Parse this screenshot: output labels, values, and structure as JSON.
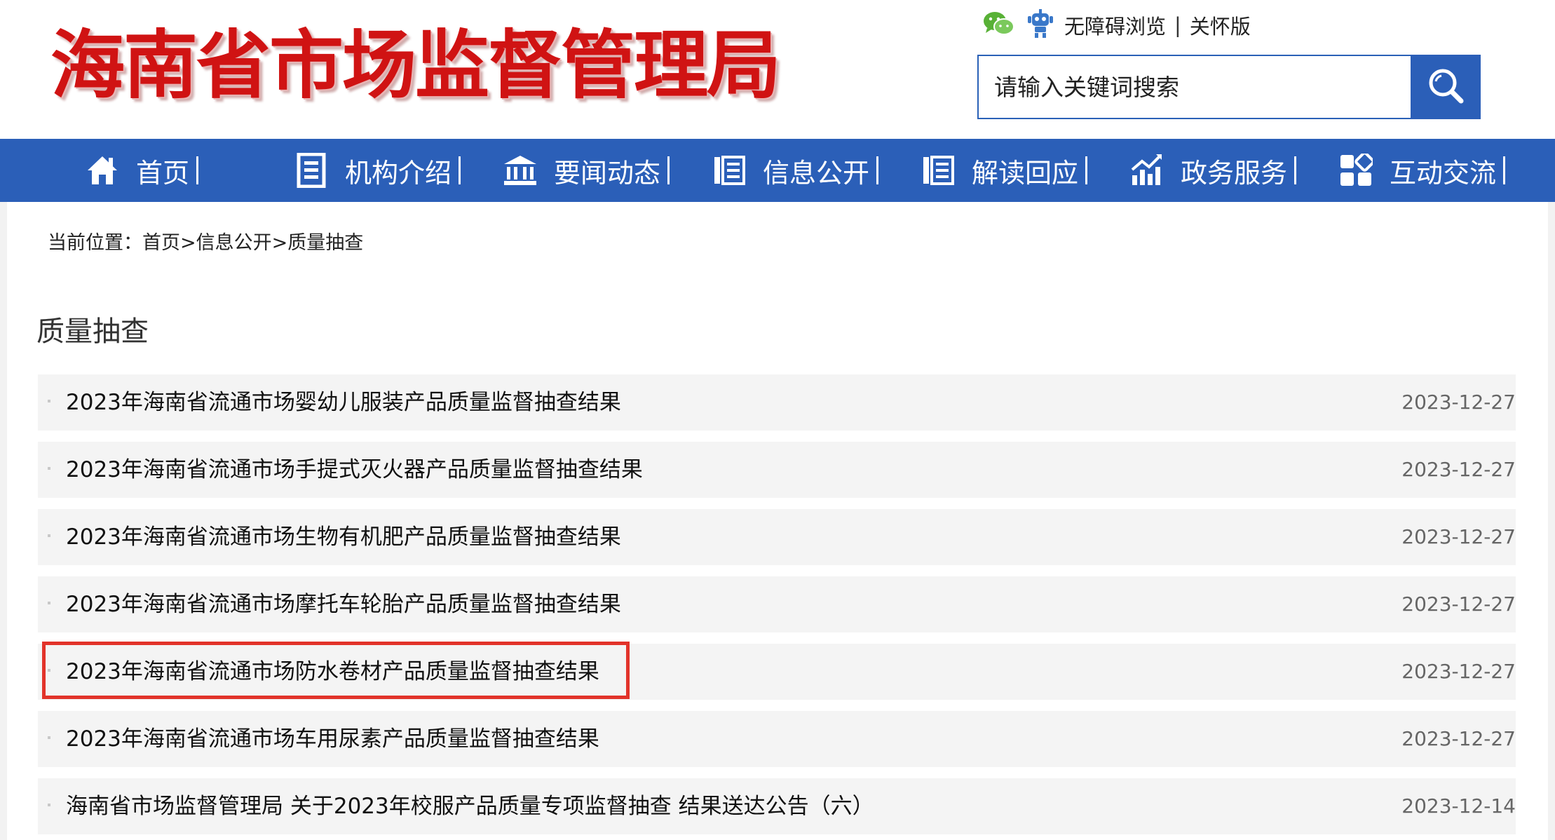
{
  "header": {
    "logo_text": "海南省市场监督管理局",
    "top_links": {
      "wechat_icon": "wechat-icon",
      "accessibility_icon": "robot-icon",
      "accessible_browse": "无障碍浏览",
      "separator": "|",
      "care_version": "关怀版"
    },
    "search": {
      "placeholder": "请输入关键词搜索",
      "button_icon": "search-icon"
    }
  },
  "nav": {
    "items": [
      {
        "label": "首页",
        "icon": "home-icon"
      },
      {
        "label": "机构介绍",
        "icon": "document-icon"
      },
      {
        "label": "要闻动态",
        "icon": "building-icon"
      },
      {
        "label": "信息公开",
        "icon": "list-icon"
      },
      {
        "label": "解读回应",
        "icon": "list-icon"
      },
      {
        "label": "政务服务",
        "icon": "chart-icon"
      },
      {
        "label": "互动交流",
        "icon": "grid-icon"
      }
    ]
  },
  "breadcrumb": {
    "prefix": "当前位置：",
    "items": [
      "首页",
      "信息公开",
      "质量抽查"
    ],
    "separator": ">"
  },
  "section": {
    "title": "质量抽查"
  },
  "articles": [
    {
      "title": "2023年海南省流通市场婴幼儿服装产品质量监督抽查结果",
      "date": "2023-12-27",
      "highlighted": false
    },
    {
      "title": "2023年海南省流通市场手提式灭火器产品质量监督抽查结果",
      "date": "2023-12-27",
      "highlighted": false
    },
    {
      "title": "2023年海南省流通市场生物有机肥产品质量监督抽查结果",
      "date": "2023-12-27",
      "highlighted": false
    },
    {
      "title": "2023年海南省流通市场摩托车轮胎产品质量监督抽查结果",
      "date": "2023-12-27",
      "highlighted": false
    },
    {
      "title": "2023年海南省流通市场防水卷材产品质量监督抽查结果",
      "date": "2023-12-27",
      "highlighted": true
    },
    {
      "title": "2023年海南省流通市场车用尿素产品质量监督抽查结果",
      "date": "2023-12-27",
      "highlighted": false
    },
    {
      "title": "海南省市场监督管理局 关于2023年校服产品质量专项监督抽查 结果送达公告（六）",
      "date": "2023-12-14",
      "highlighted": false
    }
  ],
  "colors": {
    "nav_bg": "#2b5fb8",
    "logo_red": "#d01313",
    "highlight_border": "#e2332a",
    "row_bg": "#f4f4f4"
  }
}
